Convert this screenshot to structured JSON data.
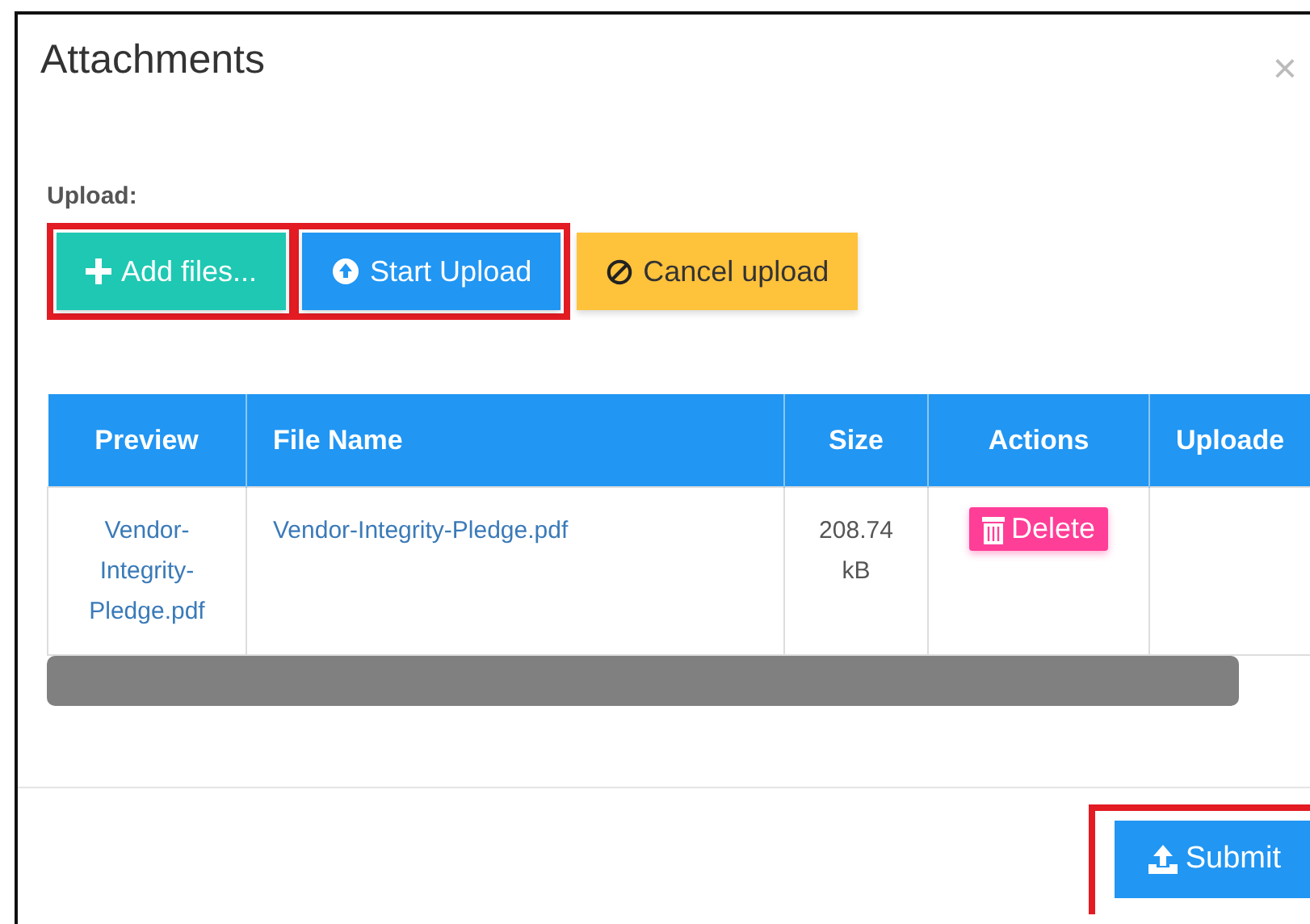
{
  "dialog": {
    "title": "Attachments",
    "close": "×"
  },
  "upload": {
    "label": "Upload:",
    "buttons": [
      {
        "kind": "add",
        "label": "Add files...",
        "highlighted": true
      },
      {
        "kind": "start",
        "label": "Start Upload",
        "highlighted": true
      },
      {
        "kind": "cancel",
        "label": "Cancel upload",
        "highlighted": false
      }
    ]
  },
  "table": {
    "columns": [
      "Preview",
      "File Name",
      "Size",
      "Actions",
      "Uploade"
    ],
    "rows": [
      {
        "preview": "Vendor-Integrity-Pledge.pdf",
        "file_name": "Vendor-Integrity-Pledge.pdf",
        "size": "208.74 kB",
        "action": "Delete"
      }
    ]
  },
  "footer": {
    "button": {
      "label": "Submit",
      "highlighted": true
    }
  }
}
